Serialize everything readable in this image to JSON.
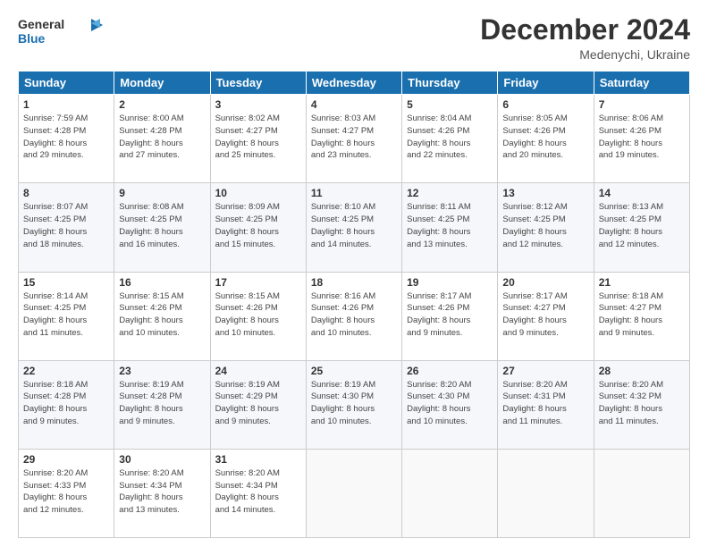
{
  "header": {
    "title": "December 2024",
    "location": "Medenychi, Ukraine"
  },
  "days": [
    "Sunday",
    "Monday",
    "Tuesday",
    "Wednesday",
    "Thursday",
    "Friday",
    "Saturday"
  ],
  "weeks": [
    [
      {
        "day": "1",
        "info": "Sunrise: 7:59 AM\nSunset: 4:28 PM\nDaylight: 8 hours\nand 29 minutes."
      },
      {
        "day": "2",
        "info": "Sunrise: 8:00 AM\nSunset: 4:28 PM\nDaylight: 8 hours\nand 27 minutes."
      },
      {
        "day": "3",
        "info": "Sunrise: 8:02 AM\nSunset: 4:27 PM\nDaylight: 8 hours\nand 25 minutes."
      },
      {
        "day": "4",
        "info": "Sunrise: 8:03 AM\nSunset: 4:27 PM\nDaylight: 8 hours\nand 23 minutes."
      },
      {
        "day": "5",
        "info": "Sunrise: 8:04 AM\nSunset: 4:26 PM\nDaylight: 8 hours\nand 22 minutes."
      },
      {
        "day": "6",
        "info": "Sunrise: 8:05 AM\nSunset: 4:26 PM\nDaylight: 8 hours\nand 20 minutes."
      },
      {
        "day": "7",
        "info": "Sunrise: 8:06 AM\nSunset: 4:26 PM\nDaylight: 8 hours\nand 19 minutes."
      }
    ],
    [
      {
        "day": "8",
        "info": "Sunrise: 8:07 AM\nSunset: 4:25 PM\nDaylight: 8 hours\nand 18 minutes."
      },
      {
        "day": "9",
        "info": "Sunrise: 8:08 AM\nSunset: 4:25 PM\nDaylight: 8 hours\nand 16 minutes."
      },
      {
        "day": "10",
        "info": "Sunrise: 8:09 AM\nSunset: 4:25 PM\nDaylight: 8 hours\nand 15 minutes."
      },
      {
        "day": "11",
        "info": "Sunrise: 8:10 AM\nSunset: 4:25 PM\nDaylight: 8 hours\nand 14 minutes."
      },
      {
        "day": "12",
        "info": "Sunrise: 8:11 AM\nSunset: 4:25 PM\nDaylight: 8 hours\nand 13 minutes."
      },
      {
        "day": "13",
        "info": "Sunrise: 8:12 AM\nSunset: 4:25 PM\nDaylight: 8 hours\nand 12 minutes."
      },
      {
        "day": "14",
        "info": "Sunrise: 8:13 AM\nSunset: 4:25 PM\nDaylight: 8 hours\nand 12 minutes."
      }
    ],
    [
      {
        "day": "15",
        "info": "Sunrise: 8:14 AM\nSunset: 4:25 PM\nDaylight: 8 hours\nand 11 minutes."
      },
      {
        "day": "16",
        "info": "Sunrise: 8:15 AM\nSunset: 4:26 PM\nDaylight: 8 hours\nand 10 minutes."
      },
      {
        "day": "17",
        "info": "Sunrise: 8:15 AM\nSunset: 4:26 PM\nDaylight: 8 hours\nand 10 minutes."
      },
      {
        "day": "18",
        "info": "Sunrise: 8:16 AM\nSunset: 4:26 PM\nDaylight: 8 hours\nand 10 minutes."
      },
      {
        "day": "19",
        "info": "Sunrise: 8:17 AM\nSunset: 4:26 PM\nDaylight: 8 hours\nand 9 minutes."
      },
      {
        "day": "20",
        "info": "Sunrise: 8:17 AM\nSunset: 4:27 PM\nDaylight: 8 hours\nand 9 minutes."
      },
      {
        "day": "21",
        "info": "Sunrise: 8:18 AM\nSunset: 4:27 PM\nDaylight: 8 hours\nand 9 minutes."
      }
    ],
    [
      {
        "day": "22",
        "info": "Sunrise: 8:18 AM\nSunset: 4:28 PM\nDaylight: 8 hours\nand 9 minutes."
      },
      {
        "day": "23",
        "info": "Sunrise: 8:19 AM\nSunset: 4:28 PM\nDaylight: 8 hours\nand 9 minutes."
      },
      {
        "day": "24",
        "info": "Sunrise: 8:19 AM\nSunset: 4:29 PM\nDaylight: 8 hours\nand 9 minutes."
      },
      {
        "day": "25",
        "info": "Sunrise: 8:19 AM\nSunset: 4:30 PM\nDaylight: 8 hours\nand 10 minutes."
      },
      {
        "day": "26",
        "info": "Sunrise: 8:20 AM\nSunset: 4:30 PM\nDaylight: 8 hours\nand 10 minutes."
      },
      {
        "day": "27",
        "info": "Sunrise: 8:20 AM\nSunset: 4:31 PM\nDaylight: 8 hours\nand 11 minutes."
      },
      {
        "day": "28",
        "info": "Sunrise: 8:20 AM\nSunset: 4:32 PM\nDaylight: 8 hours\nand 11 minutes."
      }
    ],
    [
      {
        "day": "29",
        "info": "Sunrise: 8:20 AM\nSunset: 4:33 PM\nDaylight: 8 hours\nand 12 minutes."
      },
      {
        "day": "30",
        "info": "Sunrise: 8:20 AM\nSunset: 4:34 PM\nDaylight: 8 hours\nand 13 minutes."
      },
      {
        "day": "31",
        "info": "Sunrise: 8:20 AM\nSunset: 4:34 PM\nDaylight: 8 hours\nand 14 minutes."
      },
      null,
      null,
      null,
      null
    ]
  ]
}
